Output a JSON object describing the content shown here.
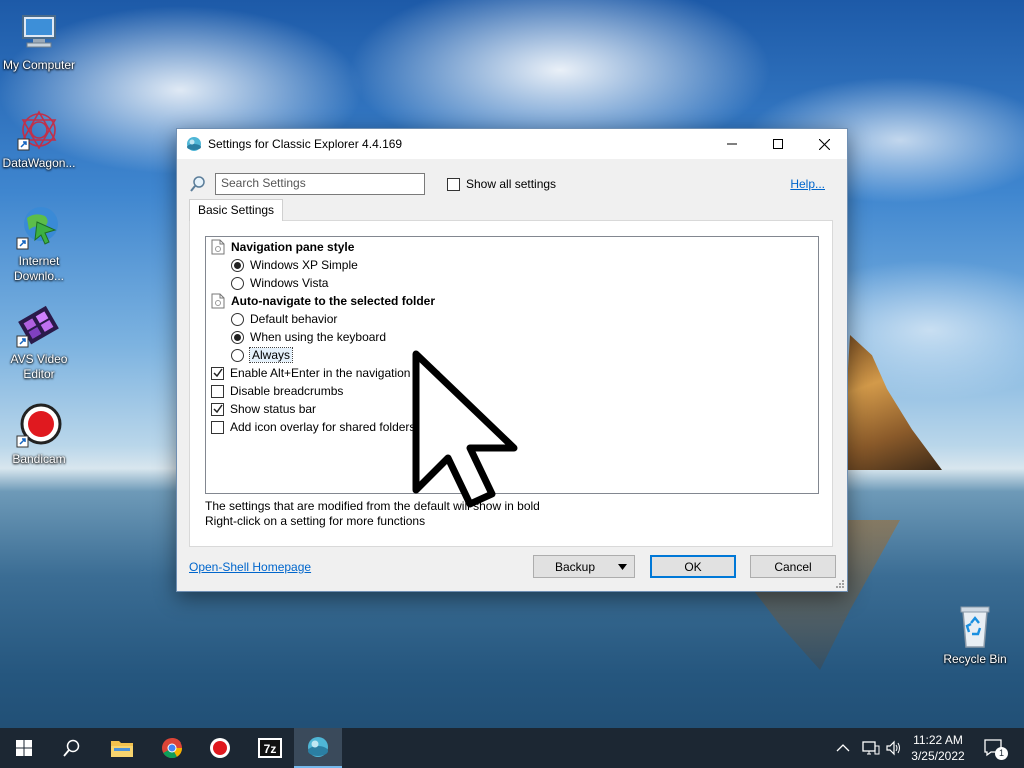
{
  "desktop": {
    "icons": [
      {
        "label": "My Computer"
      },
      {
        "label": "DataWagon..."
      },
      {
        "label": "Internet Downlo..."
      },
      {
        "label": "AVS Video Editor"
      },
      {
        "label": "Bandicam"
      },
      {
        "label": "Recycle Bin"
      }
    ]
  },
  "dialog": {
    "title": "Settings for Classic Explorer 4.4.169",
    "search_placeholder": "Search Settings",
    "show_all_label": "Show all settings",
    "show_all_checked": false,
    "help_label": "Help...",
    "tab_label": "Basic Settings",
    "settings": [
      {
        "type": "header",
        "label": "Navigation pane style"
      },
      {
        "type": "radio",
        "label": "Windows XP Simple",
        "checked": true
      },
      {
        "type": "radio",
        "label": "Windows Vista",
        "checked": false
      },
      {
        "type": "header",
        "label": "Auto-navigate to the selected folder"
      },
      {
        "type": "radio",
        "label": "Default behavior",
        "checked": false
      },
      {
        "type": "radio",
        "label": "When using the keyboard",
        "checked": true
      },
      {
        "type": "radio",
        "label": "Always",
        "checked": false,
        "focused": true
      },
      {
        "type": "checkbox",
        "label": "Enable Alt+Enter in the navigation pane",
        "checked": true
      },
      {
        "type": "checkbox",
        "label": "Disable breadcrumbs",
        "checked": false
      },
      {
        "type": "checkbox",
        "label": "Show status bar",
        "checked": true
      },
      {
        "type": "checkbox",
        "label": "Add icon overlay for shared folders",
        "checked": false
      }
    ],
    "note_line1": "The settings that are modified from the default will show in bold",
    "note_line2": "Right-click on a setting for more functions",
    "homepage_link": "Open-Shell Homepage",
    "backup_label": "Backup",
    "ok_label": "OK",
    "cancel_label": "Cancel"
  },
  "taskbar": {
    "time": "11:22 AM",
    "date": "3/25/2022",
    "notification_count": "1"
  },
  "colors": {
    "accent": "#0078d7",
    "link": "#0066cc",
    "taskbar": "#1c2733"
  }
}
